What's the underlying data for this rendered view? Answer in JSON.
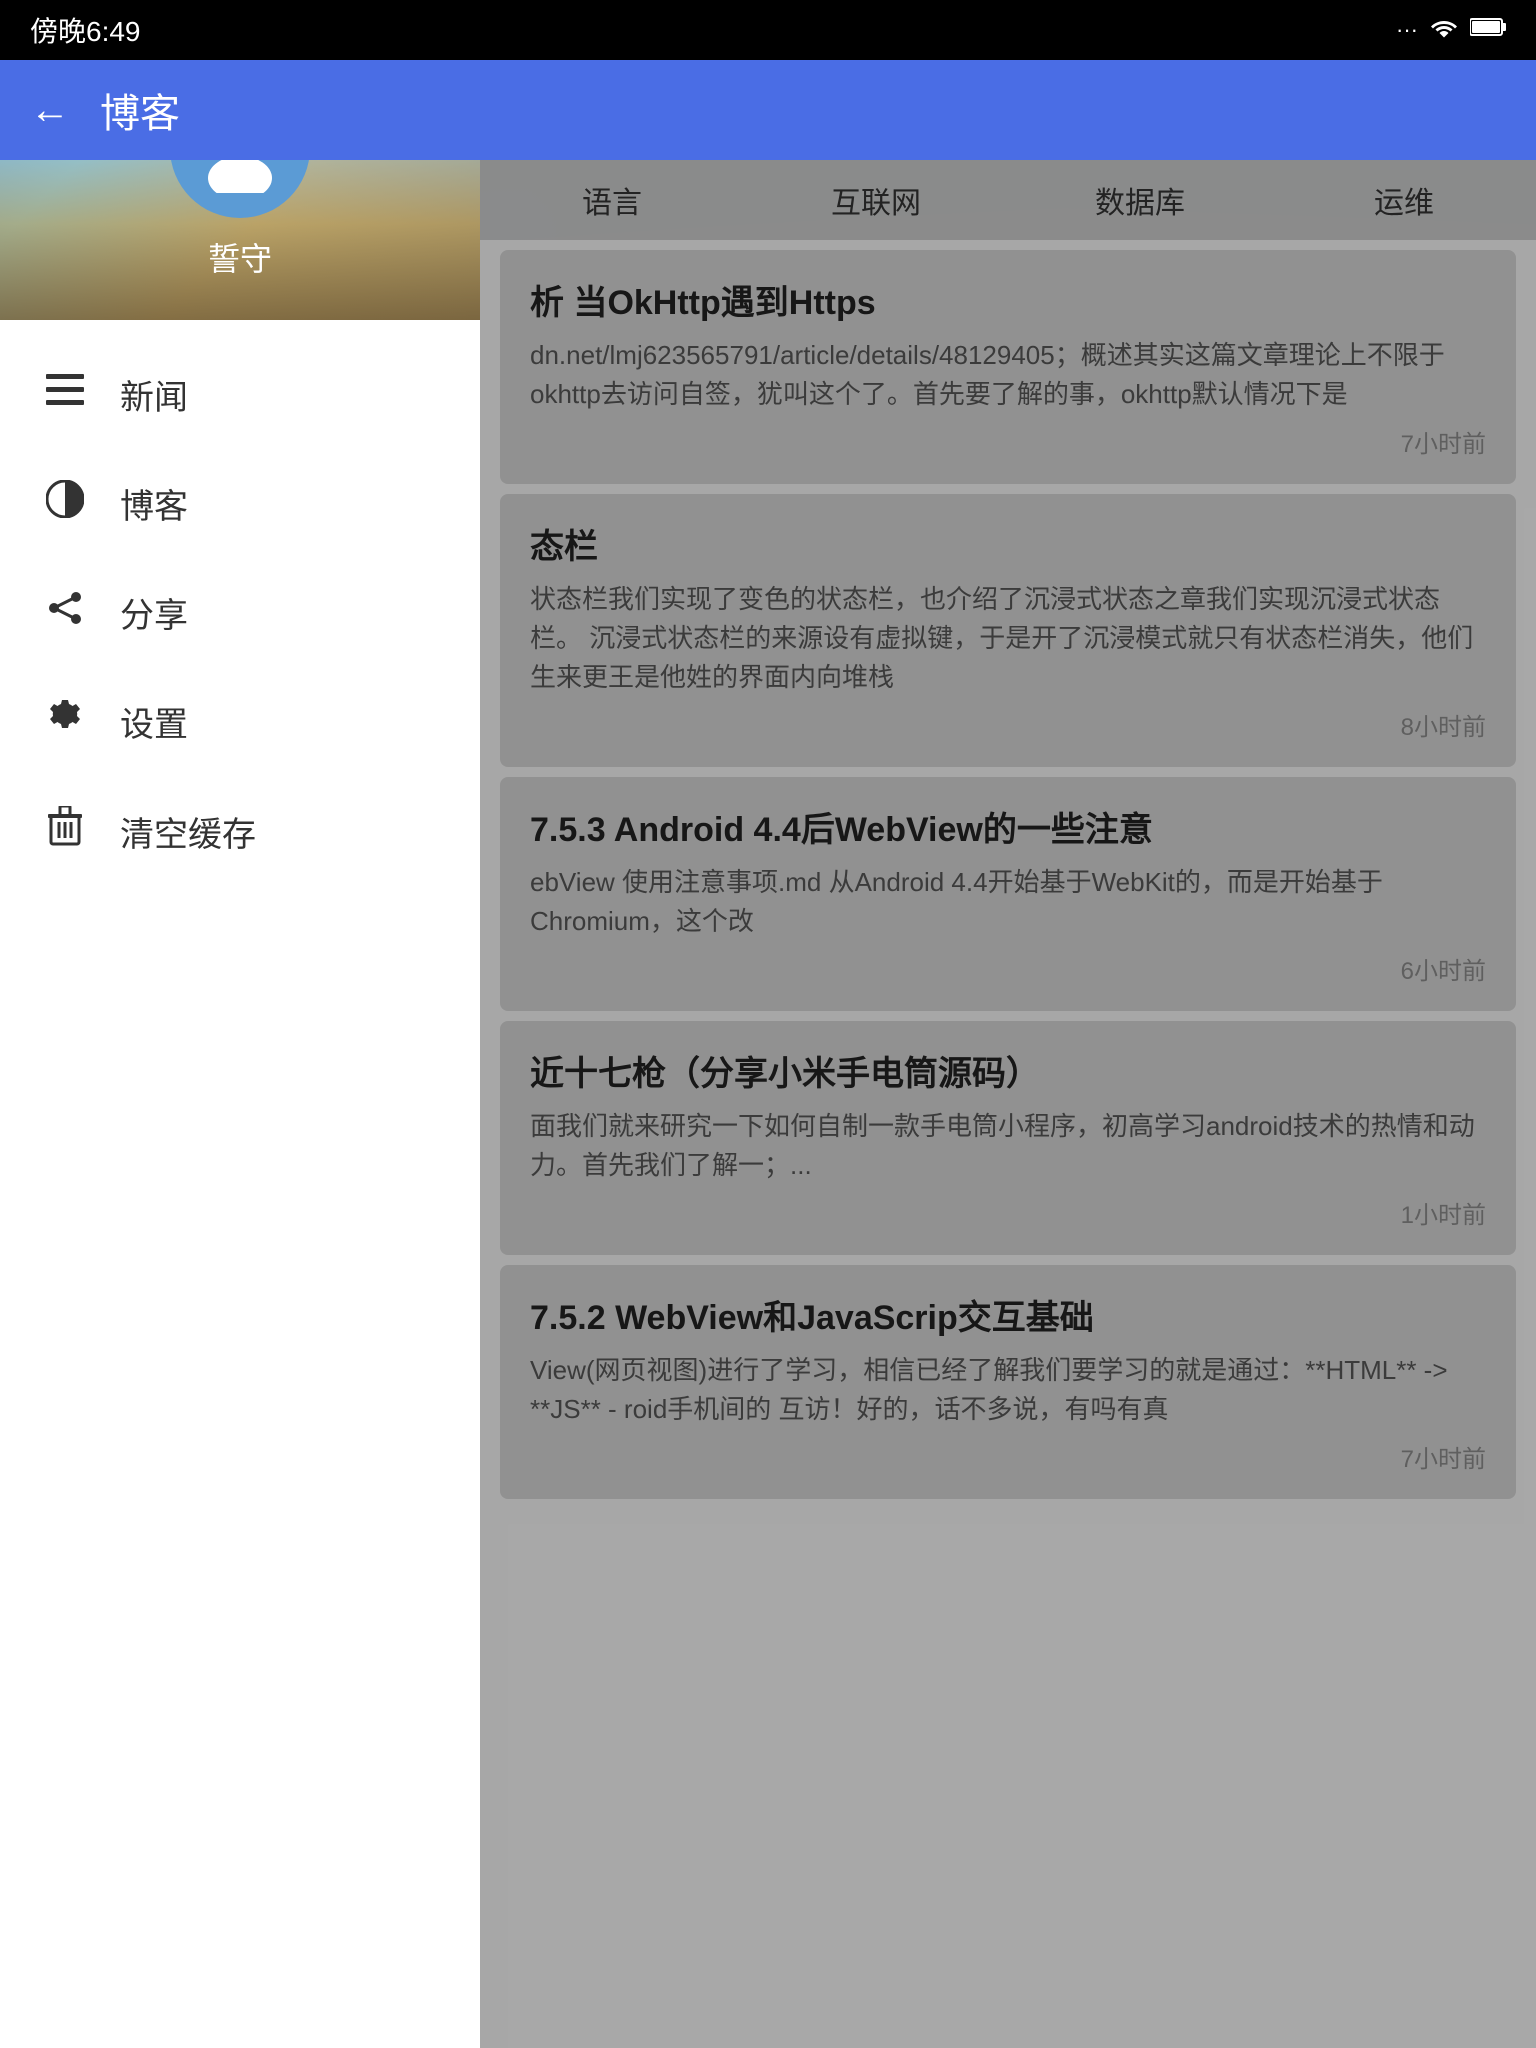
{
  "statusBar": {
    "time": "傍晚6:49",
    "icons": [
      "...",
      "📶",
      "🔋"
    ]
  },
  "appBar": {
    "backLabel": "←",
    "title": "博客"
  },
  "drawer": {
    "username": "誓守",
    "avatarIcon": "👤",
    "menuItems": [
      {
        "id": "news",
        "icon": "☰",
        "label": "新闻"
      },
      {
        "id": "blog",
        "icon": "◑",
        "label": "博客"
      },
      {
        "id": "share",
        "icon": "⋖",
        "label": "分享"
      },
      {
        "id": "settings",
        "icon": "⚙",
        "label": "设置"
      },
      {
        "id": "clear-cache",
        "icon": "🗑",
        "label": "清空缓存"
      }
    ]
  },
  "categoryTabs": [
    {
      "id": "language",
      "label": "语言"
    },
    {
      "id": "internet",
      "label": "互联网"
    },
    {
      "id": "database",
      "label": "数据库"
    },
    {
      "id": "ops",
      "label": "运维"
    }
  ],
  "articles": [
    {
      "id": 1,
      "title": "析 当OkHttp遇到Https",
      "excerpt": "dn.net/lmj623565791/article/details/48129405；概述其实这篇文章理论上不限于okhttp去访问自签，犹叫这个了。首先要了解的事，okhttp默认情况下是",
      "time": "7小时前"
    },
    {
      "id": 2,
      "title": "态栏",
      "excerpt": "状态栏我们实现了变色的状态栏，也介绍了沉浸式状态栏之章我们实现沉浸式状态栏。 沉浸式状态栏的来源，设有虚拟键，于是开了沉浸模式就只有状态栏消失，他们生来更王是他姓的界面内向堆栈",
      "time": "8小时前"
    },
    {
      "id": 3,
      "title": "7.5.3 Android 4.4后WebView的一些注意",
      "excerpt": "ebView 使用注意事项.md 从Android 4.4开始基于WebKit的，而是开始基于Chromium，这个改",
      "time": "6小时前"
    },
    {
      "id": 4,
      "title": "近十七枪（分享小米手电筒源码）",
      "excerpt": "面我们就来研究一下如何自制一款手电筒小程序，初高学习android技术的热情和动力。首先我们了解一；...",
      "time": "1小时前"
    },
    {
      "id": 5,
      "title": "7.5.2 WebView和JavaScrip交互基础",
      "excerpt": "View(网页视图)进行了学习，相信已经了解我们要学习的就是通过：**HTML** -> **JS** - roid手机间的 互访！好的，话不多说，有吗有真",
      "time": "7小时前"
    }
  ]
}
